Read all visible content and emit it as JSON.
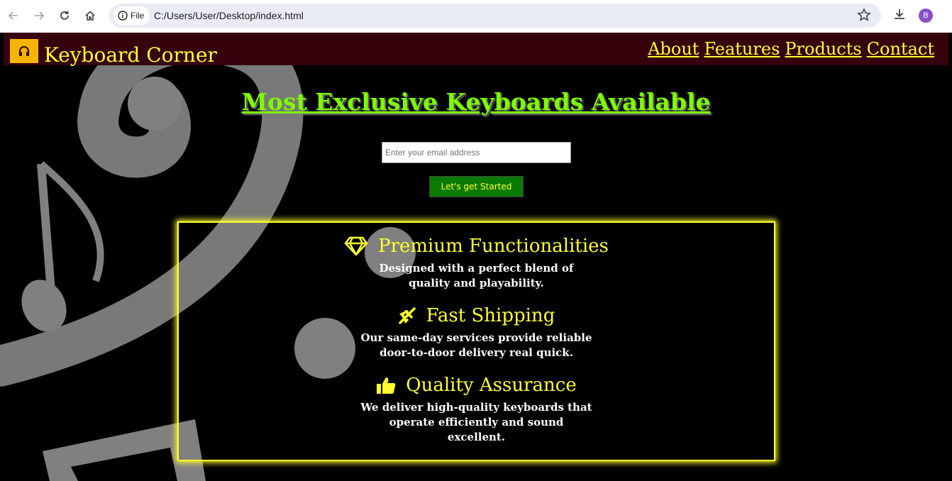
{
  "browser": {
    "file_label": "File",
    "url": "C:/Users/User/Desktop/index.html",
    "avatar_letter": "B"
  },
  "header": {
    "brand": "Keyboard Corner",
    "logo_icon": "headphones-icon",
    "nav": [
      {
        "label": "About"
      },
      {
        "label": "Features"
      },
      {
        "label": "Products"
      },
      {
        "label": "Contact"
      }
    ]
  },
  "hero": {
    "title": "Most Exclusive Keyboards Available",
    "email_placeholder": "Enter your email address",
    "cta_label": "Let's get Started"
  },
  "features": [
    {
      "icon": "diamond-icon",
      "title": "Premium Functionalities",
      "desc": "Designed with a perfect blend of quality and playability."
    },
    {
      "icon": "airplane-icon",
      "title": "Fast Shipping",
      "desc": "Our same-day services provide reliable door-to-door delivery real quick."
    },
    {
      "icon": "thumbs-up-icon",
      "title": "Quality Assurance",
      "desc": "We deliver high-quality keyboards that operate efficiently and sound excellent."
    }
  ],
  "colors": {
    "header_bg": "#36030c",
    "accent_yellow": "#ffff2e",
    "hero_green": "#7cfc00",
    "cta_bg": "#0a7a00"
  }
}
